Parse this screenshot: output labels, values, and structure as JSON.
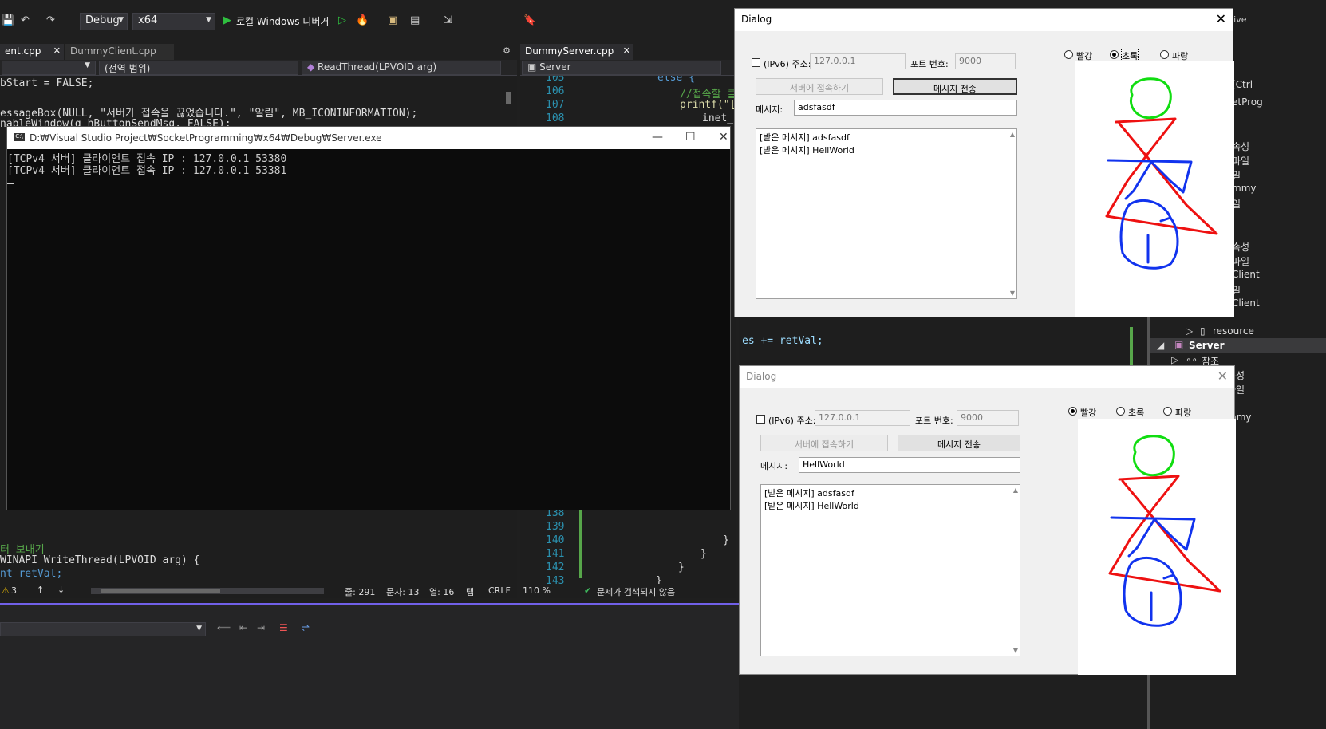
{
  "vs": {
    "toolbar": {
      "config": "Debug",
      "platform": "x64",
      "debugger_label": "로컬 Windows 디버거"
    },
    "left_tabs": {
      "tab1": "ent.cpp",
      "tab2": "DummyClient.cpp"
    },
    "left_nav": {
      "scope": "(전역 범위)",
      "function": "ReadThread(LPVOID arg)"
    },
    "right_tabs": {
      "tab1": "DummyServer.cpp"
    },
    "right_nav": {
      "project": "Server"
    },
    "left_code_top": [
      "bStart = FALSE;",
      "",
      "essageBox(NULL, \"서버가 접속을 끊었습니다.\", \"알림\", MB_ICONINFORMATION);",
      "nableWindow(g_hButtonSendMsg, FALSE);"
    ],
    "left_code_bottom": [
      "터 보내기",
      "WINAPI WriteThread(LPVOID arg) {",
      "nt retVal;"
    ],
    "right_code_top": {
      "lines": [
        "105",
        "106",
        "107",
        "108"
      ],
      "code": [
        "else {",
        "//접속할 클",
        "printf(\"[T",
        "inet_n"
      ]
    },
    "right_code_mid": "es += retVal;",
    "right_code_bottom": {
      "lines": [
        "138",
        "139",
        "140",
        "141",
        "142",
        "143"
      ]
    },
    "left_status": {
      "warnings": "3",
      "line": "줄: 291",
      "char": "문자: 13",
      "col": "열: 16",
      "tab": "탭",
      "eol": "CRLF"
    },
    "right_status": {
      "zoom": "110 %",
      "issues": "문제가 검색되지 않음"
    }
  },
  "console": {
    "title": "D:₩Visual Studio Project₩SocketProgramming₩x64₩Debug₩Server.exe",
    "lines": [
      "[TCPv4 서버] 클라이언트 접속 IP : 127.0.0.1 53380",
      "[TCPv4 서버] 클라이언트 접속 IP : 127.0.0.1 53381"
    ]
  },
  "dialog1": {
    "title": "Dialog",
    "ipv6_label": "(IPv6) 주소:",
    "address": "127.0.0.1",
    "port_label": "포트 번호:",
    "port": "9000",
    "connect_button": "서버에 접속하기",
    "send_button": "메시지 전송",
    "message_label": "메시지:",
    "message": "adsfasdf",
    "received": [
      "[받은 메시지] adsfasdf",
      "[받은 메시지] HellWorld"
    ],
    "colors": {
      "red": "빨강",
      "green": "초록",
      "blue": "파랑",
      "selected": "green"
    }
  },
  "dialog2": {
    "title": "Dialog",
    "ipv6_label": "(IPv6) 주소:",
    "address": "127.0.0.1",
    "port_label": "포트 번호:",
    "port": "9000",
    "connect_button": "서버에 접속하기",
    "send_button": "메시지 전송",
    "message_label": "메시지:",
    "message": "HellWorld",
    "received": [
      "[받은 메시지] adsfasdf",
      "[받은 메시지] HellWorld"
    ],
    "colors": {
      "red": "빨강",
      "green": "초록",
      "blue": "파랑",
      "selected": "red"
    }
  },
  "solution_explorer": {
    "items": [
      "속성",
      "파일",
      "일",
      "mmy",
      "일",
      "속성",
      "파일",
      "Client",
      "일",
      "Client",
      "resource",
      "Server",
      "참조",
      "속성",
      "파일",
      "일",
      "mmy",
      "일"
    ],
    "live": "Live",
    "search_hint": "(Ctrl-",
    "proj_hint": "etProg"
  },
  "colors": {
    "accent": "#7160e8",
    "green_stroke": "#11dd11",
    "red_stroke": "#ee1111",
    "blue_stroke": "#1133ee"
  }
}
